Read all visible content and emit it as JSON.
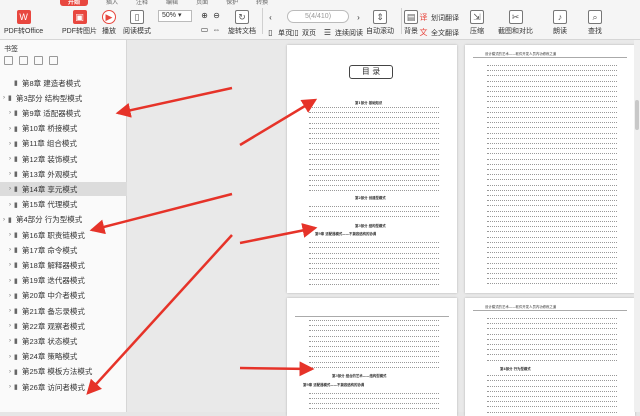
{
  "toolbar": {
    "tabs": [
      "开始",
      "插入",
      "注释",
      "编辑",
      "页面",
      "保护",
      "转换"
    ],
    "active_tab": "开始",
    "buttons": [
      {
        "label": "PDF转Office",
        "icon": "pdf-to-office-icon"
      },
      {
        "label": "PDF转图片",
        "icon": "pdf-to-image-icon"
      },
      {
        "label": "播放",
        "icon": "play-icon"
      },
      {
        "label": "阅读模式",
        "icon": "read-mode-icon"
      },
      {
        "label": "旋转文档",
        "icon": "rotate-icon"
      },
      {
        "label": "单页",
        "icon": "single-page-icon"
      },
      {
        "label": "双页",
        "icon": "double-page-icon"
      },
      {
        "label": "连续阅读",
        "icon": "continuous-icon"
      },
      {
        "label": "自动滚动",
        "icon": "autoscroll-icon"
      },
      {
        "label": "背景",
        "icon": "background-icon"
      },
      {
        "label": "全文翻译",
        "icon": "translate-icon"
      },
      {
        "label": "划词翻译",
        "icon": "word-translate-icon"
      },
      {
        "label": "压缩",
        "icon": "compress-icon"
      },
      {
        "label": "截图和对比",
        "icon": "screenshot-icon"
      },
      {
        "label": "朗读",
        "icon": "read-aloud-icon"
      },
      {
        "label": "查找",
        "icon": "search-icon"
      }
    ],
    "zoom": "50%",
    "page_indicator": "5(4/410)"
  },
  "sidebar": {
    "title": "书签",
    "items": [
      {
        "label": "第8章 建造者模式",
        "level": 1,
        "expand": false
      },
      {
        "label": "第3部分 结构型模式",
        "level": 0,
        "expand": true
      },
      {
        "label": "第9章 适配器模式",
        "level": 1,
        "expand": true
      },
      {
        "label": "第10章 桥接模式",
        "level": 1,
        "expand": true
      },
      {
        "label": "第11章 组合模式",
        "level": 1,
        "expand": true
      },
      {
        "label": "第12章 装饰模式",
        "level": 1,
        "expand": true
      },
      {
        "label": "第13章 外观模式",
        "level": 1,
        "expand": true
      },
      {
        "label": "第14章 享元模式",
        "level": 1,
        "expand": true,
        "selected": true
      },
      {
        "label": "第15章 代理模式",
        "level": 1,
        "expand": true
      },
      {
        "label": "第4部分 行为型模式",
        "level": 0,
        "expand": true
      },
      {
        "label": "第16章 职责链模式",
        "level": 1,
        "expand": true
      },
      {
        "label": "第17章 命令模式",
        "level": 1,
        "expand": true
      },
      {
        "label": "第18章 解释器模式",
        "level": 1,
        "expand": true
      },
      {
        "label": "第19章 迭代器模式",
        "level": 1,
        "expand": true
      },
      {
        "label": "第20章 中介者模式",
        "level": 1,
        "expand": true
      },
      {
        "label": "第21章 备忘录模式",
        "level": 1,
        "expand": true
      },
      {
        "label": "第22章 观察者模式",
        "level": 1,
        "expand": true
      },
      {
        "label": "第23章 状态模式",
        "level": 1,
        "expand": true
      },
      {
        "label": "第24章 策略模式",
        "level": 1,
        "expand": true
      },
      {
        "label": "第25章 模板方法模式",
        "level": 1,
        "expand": true
      },
      {
        "label": "第26章 访问者模式",
        "level": 1,
        "expand": true
      }
    ]
  },
  "pages": {
    "toc_title": "目 录",
    "p1_part1": "第1部分 基础知识",
    "p1_part2": "第2部分 创建型模式",
    "p1_part3": "第3部分 结构型模式",
    "p1_ch9": "第9章 适配器模式——不兼容结构的协调",
    "running_head": "设计模式的艺术——软件开发人员内功修炼之道",
    "p3_part": "第3部分 结合的艺术——结构型模式",
    "p3_ch9": "第9章 适配器模式——不兼容结构的协调",
    "p4_ch16": "第16章 职责链模式——请求的链式处理",
    "p4_part": "第4部分 行为型模式"
  }
}
